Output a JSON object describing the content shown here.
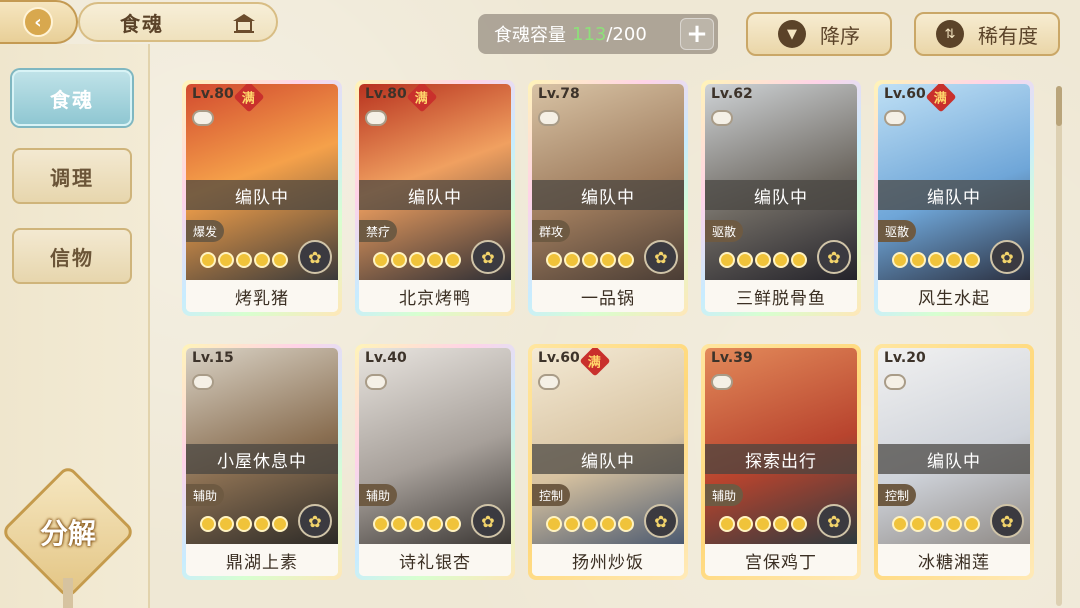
{
  "header": {
    "title": "食魂",
    "capacity_label": "食魂容量",
    "capacity_current": "113",
    "capacity_max": "/200",
    "sort_order_label": "降序",
    "sort_rarity_label": "稀有度"
  },
  "sidebar": {
    "tabs": [
      {
        "label": "食魂",
        "active": true
      },
      {
        "label": "调理",
        "active": false
      },
      {
        "label": "信物",
        "active": false
      }
    ],
    "decompose_label": "分解"
  },
  "cards": [
    {
      "level": "Lv.80",
      "maxed": "满",
      "status": "编队中",
      "role": "爆发",
      "name": "烤乳猪"
    },
    {
      "level": "Lv.80",
      "maxed": "满",
      "status": "编队中",
      "role": "禁疗",
      "name": "北京烤鸭"
    },
    {
      "level": "Lv.78",
      "maxed": "",
      "status": "编队中",
      "role": "群攻",
      "name": "一品锅"
    },
    {
      "level": "Lv.62",
      "maxed": "",
      "status": "编队中",
      "role": "驱散",
      "name": "三鲜脱骨鱼"
    },
    {
      "level": "Lv.60",
      "maxed": "满",
      "status": "编队中",
      "role": "驱散",
      "name": "风生水起"
    },
    {
      "level": "Lv.15",
      "maxed": "",
      "status": "小屋休息中",
      "role": "辅助",
      "name": "鼎湖上素"
    },
    {
      "level": "Lv.40",
      "maxed": "",
      "status": "",
      "role": "辅助",
      "name": "诗礼银杏"
    },
    {
      "level": "Lv.60",
      "maxed": "满",
      "status": "编队中",
      "role": "控制",
      "name": "扬州炒饭"
    },
    {
      "level": "Lv.39",
      "maxed": "",
      "status": "探索出行",
      "role": "辅助",
      "name": "宫保鸡丁"
    },
    {
      "level": "Lv.20",
      "maxed": "",
      "status": "编队中",
      "role": "控制",
      "name": "冰糖湘莲"
    }
  ],
  "colors": {
    "accent_green": "#8ee07a",
    "active_tab": "#8fc7d2",
    "badge_red": "#c9302c",
    "status_overlay": "#464440"
  }
}
